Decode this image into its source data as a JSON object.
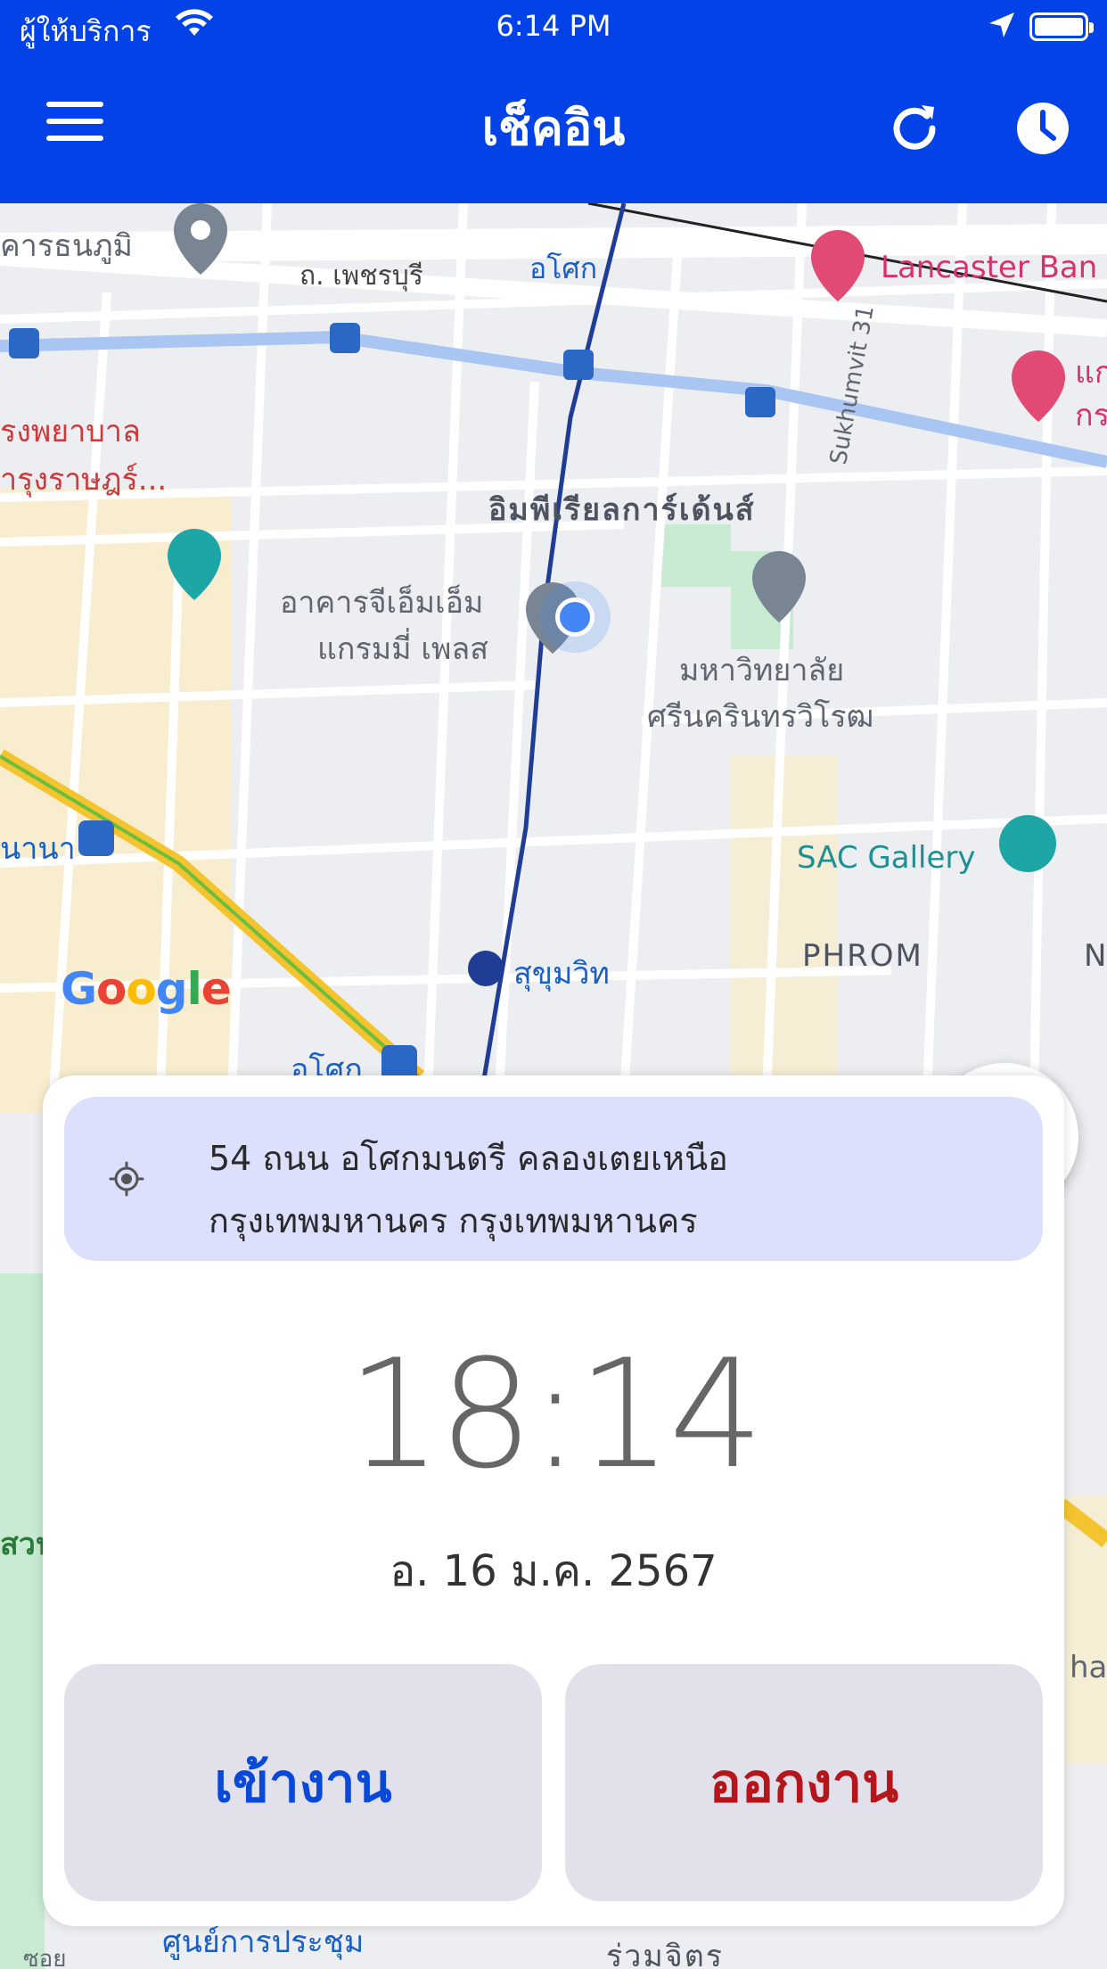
{
  "status_bar": {
    "carrier": "ผู้ให้บริการ",
    "time": "6:14 PM"
  },
  "header": {
    "title": "เช็คอิน",
    "background": "#0242e6",
    "menu_icon": "hamburger-icon",
    "refresh_icon": "refresh-icon",
    "history_icon": "clock-icon"
  },
  "map": {
    "labels": {
      "bank": "คารธนภูมิ",
      "petchburi": "ถ. เพชรบุรี",
      "asok_top": "อโศก",
      "lancaster": "Lancaster Ban",
      "right_top_1": "แก",
      "right_top_2": "กร",
      "hospital_1": "รงพยาบาล",
      "hospital_2": "ำรุงราษฎร์...",
      "imperial": "อิมพีเรียลการ์เด้นส์",
      "sukhumvit31": "Sukhumvit 31",
      "gmm_1": "อาคารจีเอ็มเอ็ม",
      "gmm_2": "แกรมมี่ เพลส",
      "swu_1": "มหาวิทยาลัย",
      "swu_2": "ศรีนครินทรวิโรฒ",
      "nana": "นานา",
      "sac": "SAC Gallery",
      "phrom": "PHROM",
      "phrom_end": "NG",
      "sukhumvit_mrt": "สุขุมวิท",
      "asok_bottom": "อโศก",
      "suan": "สวน",
      "hai": "hai",
      "ruamchit": "ร่วมจิตร",
      "convention": "ศูนย์การประชุม",
      "soi": "ซอย"
    },
    "google": [
      "G",
      "o",
      "o",
      "g",
      "l",
      "e"
    ],
    "google_colors": [
      "#4285F4",
      "#EA4335",
      "#FBBC05",
      "#4285F4",
      "#34A853",
      "#EA4335"
    ],
    "locate_icon": "my-location-icon"
  },
  "card": {
    "address_icon": "crosshair-icon",
    "address_line1": "54 ถนน อโศกมนตรี คลองเตยเหนือ",
    "address_line2": "กรุงเทพมหานคร กรุงเทพมหานคร",
    "time": "18:14",
    "date": "อ. 16 ม.ค. 2567",
    "check_in_label": "เข้างาน",
    "check_out_label": "ออกงาน",
    "check_in_color": "#0a48d8",
    "check_out_color": "#b5161c"
  }
}
